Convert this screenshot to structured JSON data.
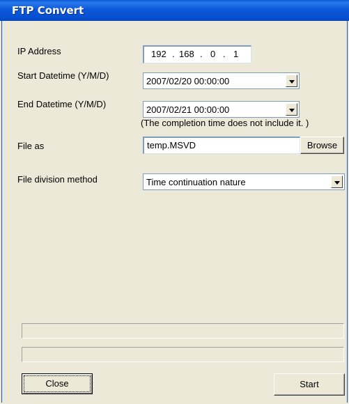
{
  "window": {
    "title": "FTP Convert"
  },
  "form": {
    "ip_label": "IP Address",
    "ip": [
      "192",
      "168",
      "0",
      "1"
    ],
    "start_label": "Start Datetime (Y/M/D)",
    "start_value": "2007/02/20 00:00:00",
    "end_label": "End Datetime (Y/M/D)",
    "end_value": "2007/02/21 00:00:00",
    "note": "(The completion time does not include it. )",
    "file_label": "File as",
    "file_value": "temp.MSVD",
    "browse_label": "Browse",
    "division_label": "File division method",
    "division_value": "Time continuation nature"
  },
  "progress": {
    "bar1": 0,
    "bar2": 0
  },
  "buttons": {
    "close": "Close",
    "start": "Start"
  }
}
